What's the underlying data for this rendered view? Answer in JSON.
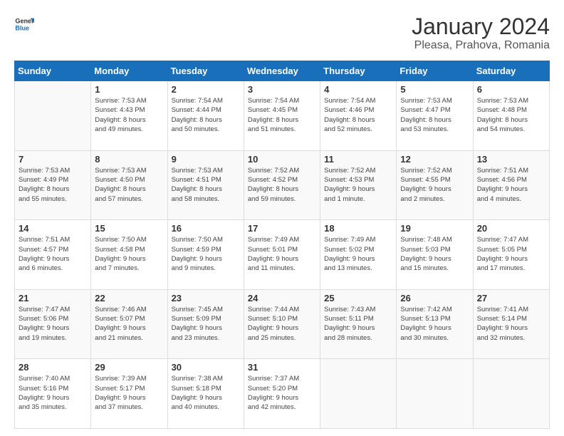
{
  "logo": {
    "text_general": "General",
    "text_blue": "Blue"
  },
  "title": "January 2024",
  "subtitle": "Pleasa, Prahova, Romania",
  "days_header": [
    "Sunday",
    "Monday",
    "Tuesday",
    "Wednesday",
    "Thursday",
    "Friday",
    "Saturday"
  ],
  "weeks": [
    [
      {
        "day": "",
        "info": ""
      },
      {
        "day": "1",
        "info": "Sunrise: 7:53 AM\nSunset: 4:43 PM\nDaylight: 8 hours\nand 49 minutes."
      },
      {
        "day": "2",
        "info": "Sunrise: 7:54 AM\nSunset: 4:44 PM\nDaylight: 8 hours\nand 50 minutes."
      },
      {
        "day": "3",
        "info": "Sunrise: 7:54 AM\nSunset: 4:45 PM\nDaylight: 8 hours\nand 51 minutes."
      },
      {
        "day": "4",
        "info": "Sunrise: 7:54 AM\nSunset: 4:46 PM\nDaylight: 8 hours\nand 52 minutes."
      },
      {
        "day": "5",
        "info": "Sunrise: 7:53 AM\nSunset: 4:47 PM\nDaylight: 8 hours\nand 53 minutes."
      },
      {
        "day": "6",
        "info": "Sunrise: 7:53 AM\nSunset: 4:48 PM\nDaylight: 8 hours\nand 54 minutes."
      }
    ],
    [
      {
        "day": "7",
        "info": "Sunrise: 7:53 AM\nSunset: 4:49 PM\nDaylight: 8 hours\nand 55 minutes."
      },
      {
        "day": "8",
        "info": "Sunrise: 7:53 AM\nSunset: 4:50 PM\nDaylight: 8 hours\nand 57 minutes."
      },
      {
        "day": "9",
        "info": "Sunrise: 7:53 AM\nSunset: 4:51 PM\nDaylight: 8 hours\nand 58 minutes."
      },
      {
        "day": "10",
        "info": "Sunrise: 7:52 AM\nSunset: 4:52 PM\nDaylight: 8 hours\nand 59 minutes."
      },
      {
        "day": "11",
        "info": "Sunrise: 7:52 AM\nSunset: 4:53 PM\nDaylight: 9 hours\nand 1 minute."
      },
      {
        "day": "12",
        "info": "Sunrise: 7:52 AM\nSunset: 4:55 PM\nDaylight: 9 hours\nand 2 minutes."
      },
      {
        "day": "13",
        "info": "Sunrise: 7:51 AM\nSunset: 4:56 PM\nDaylight: 9 hours\nand 4 minutes."
      }
    ],
    [
      {
        "day": "14",
        "info": "Sunrise: 7:51 AM\nSunset: 4:57 PM\nDaylight: 9 hours\nand 6 minutes."
      },
      {
        "day": "15",
        "info": "Sunrise: 7:50 AM\nSunset: 4:58 PM\nDaylight: 9 hours\nand 7 minutes."
      },
      {
        "day": "16",
        "info": "Sunrise: 7:50 AM\nSunset: 4:59 PM\nDaylight: 9 hours\nand 9 minutes."
      },
      {
        "day": "17",
        "info": "Sunrise: 7:49 AM\nSunset: 5:01 PM\nDaylight: 9 hours\nand 11 minutes."
      },
      {
        "day": "18",
        "info": "Sunrise: 7:49 AM\nSunset: 5:02 PM\nDaylight: 9 hours\nand 13 minutes."
      },
      {
        "day": "19",
        "info": "Sunrise: 7:48 AM\nSunset: 5:03 PM\nDaylight: 9 hours\nand 15 minutes."
      },
      {
        "day": "20",
        "info": "Sunrise: 7:47 AM\nSunset: 5:05 PM\nDaylight: 9 hours\nand 17 minutes."
      }
    ],
    [
      {
        "day": "21",
        "info": "Sunrise: 7:47 AM\nSunset: 5:06 PM\nDaylight: 9 hours\nand 19 minutes."
      },
      {
        "day": "22",
        "info": "Sunrise: 7:46 AM\nSunset: 5:07 PM\nDaylight: 9 hours\nand 21 minutes."
      },
      {
        "day": "23",
        "info": "Sunrise: 7:45 AM\nSunset: 5:09 PM\nDaylight: 9 hours\nand 23 minutes."
      },
      {
        "day": "24",
        "info": "Sunrise: 7:44 AM\nSunset: 5:10 PM\nDaylight: 9 hours\nand 25 minutes."
      },
      {
        "day": "25",
        "info": "Sunrise: 7:43 AM\nSunset: 5:11 PM\nDaylight: 9 hours\nand 28 minutes."
      },
      {
        "day": "26",
        "info": "Sunrise: 7:42 AM\nSunset: 5:13 PM\nDaylight: 9 hours\nand 30 minutes."
      },
      {
        "day": "27",
        "info": "Sunrise: 7:41 AM\nSunset: 5:14 PM\nDaylight: 9 hours\nand 32 minutes."
      }
    ],
    [
      {
        "day": "28",
        "info": "Sunrise: 7:40 AM\nSunset: 5:16 PM\nDaylight: 9 hours\nand 35 minutes."
      },
      {
        "day": "29",
        "info": "Sunrise: 7:39 AM\nSunset: 5:17 PM\nDaylight: 9 hours\nand 37 minutes."
      },
      {
        "day": "30",
        "info": "Sunrise: 7:38 AM\nSunset: 5:18 PM\nDaylight: 9 hours\nand 40 minutes."
      },
      {
        "day": "31",
        "info": "Sunrise: 7:37 AM\nSunset: 5:20 PM\nDaylight: 9 hours\nand 42 minutes."
      },
      {
        "day": "",
        "info": ""
      },
      {
        "day": "",
        "info": ""
      },
      {
        "day": "",
        "info": ""
      }
    ]
  ]
}
